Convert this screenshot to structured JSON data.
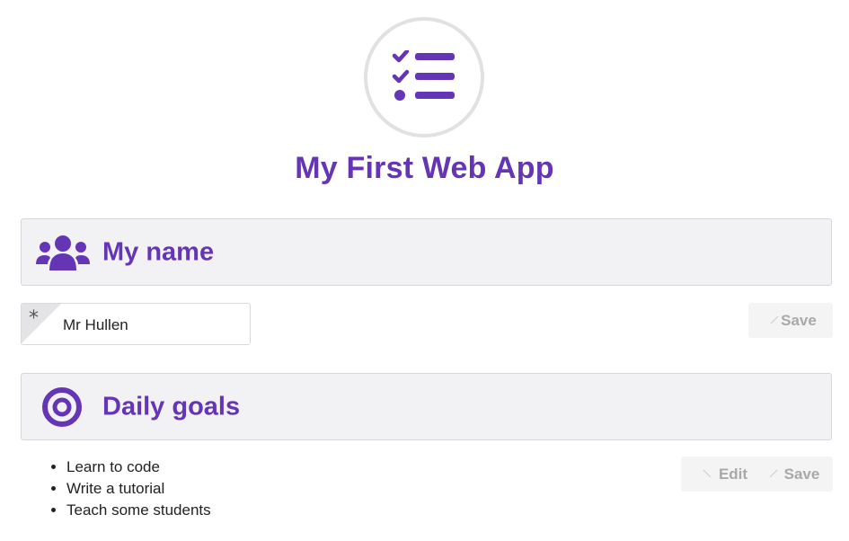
{
  "app": {
    "title": "My First Web App",
    "logo_icon": "checklist-icon",
    "accent_color": "#6435b5"
  },
  "name_section": {
    "title": "My name",
    "icon": "users-icon",
    "required_marker": "*",
    "name_value": "Mr Hullen",
    "save_label": "Save"
  },
  "goals_section": {
    "title": "Daily goals",
    "icon": "target-icon",
    "items": [
      "Learn to code",
      "Write a tutorial",
      "Teach some students"
    ],
    "edit_label": "Edit",
    "save_label": "Save"
  }
}
